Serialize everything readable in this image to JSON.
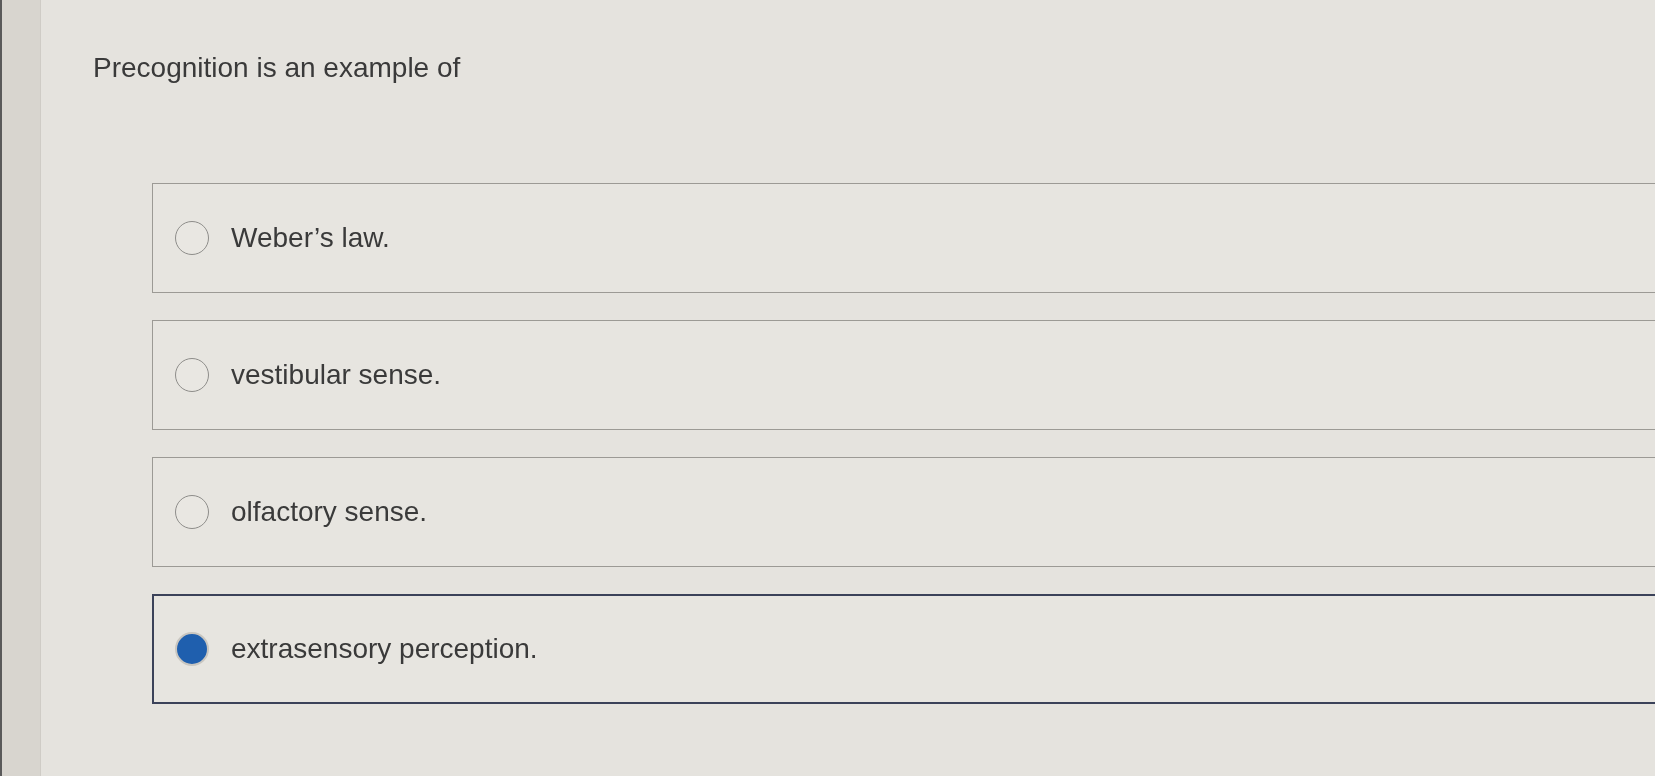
{
  "question": {
    "text": "Precognition is an example of"
  },
  "options": [
    {
      "label": "Weber’s law.",
      "selected": false
    },
    {
      "label": "vestibular sense.",
      "selected": false
    },
    {
      "label": "olfactory sense.",
      "selected": false
    },
    {
      "label": "extrasensory perception.",
      "selected": true
    }
  ]
}
